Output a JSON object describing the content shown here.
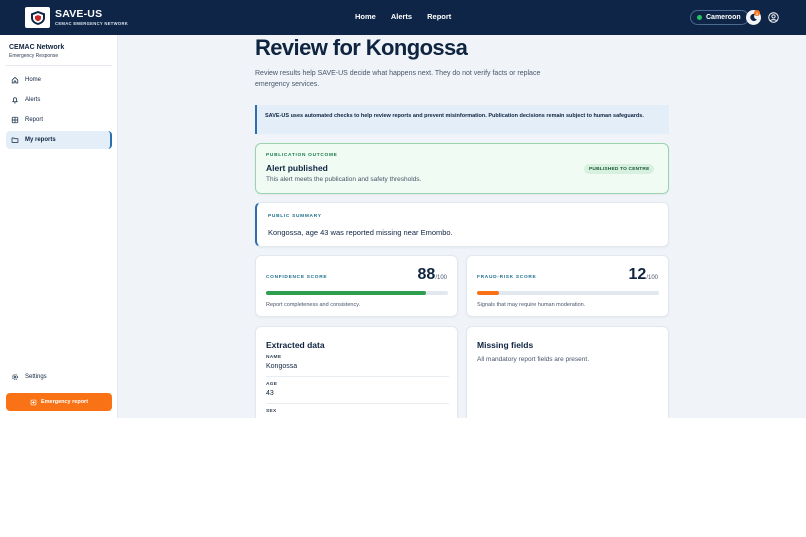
{
  "header": {
    "brand_title": "SAVE-US",
    "brand_subtitle": "CEMAC EMERGENCY NETWORK",
    "nav": [
      "Home",
      "Alerts",
      "Report"
    ],
    "country": "Cameroon",
    "notification_count": "1"
  },
  "sidebar": {
    "org_name": "CEMAC Network",
    "org_sub": "Emergency Response",
    "items": [
      {
        "label": "Home",
        "icon": "home-icon"
      },
      {
        "label": "Alerts",
        "icon": "bell-icon"
      },
      {
        "label": "Report",
        "icon": "grid-icon"
      },
      {
        "label": "My reports",
        "icon": "folder-icon"
      }
    ],
    "settings_label": "Settings",
    "emergency_label": "Emergency report"
  },
  "main": {
    "title": "Review for Kongossa",
    "intro": "Review results help SAVE-US decide what happens next. They do not verify facts or replace emergency services.",
    "notice": "SAVE-US uses automated checks to help review reports and prevent misinformation. Publication decisions remain subject to human safeguards.",
    "outcome": {
      "eyebrow": "PUBLICATION OUTCOME",
      "title": "Alert published",
      "desc": "This alert meets the publication and safety thresholds.",
      "badge": "PUBLISHED TO CENTRE"
    },
    "summary": {
      "eyebrow": "PUBLIC SUMMARY",
      "text": "Kongossa, age 43 was reported missing near Emombo."
    },
    "confidence": {
      "eyebrow": "CONFIDENCE SCORE",
      "value": "88",
      "max": "/100",
      "level": 0.88,
      "color": "#2e9e4f",
      "desc": "Report completeness and consistency."
    },
    "fraud": {
      "eyebrow": "FRAUD-RISK SCORE",
      "value": "12",
      "max": "/100",
      "level": 0.12,
      "color": "#f97316",
      "desc": "Signals that may require human moderation."
    },
    "extracted": {
      "title": "Extracted data",
      "fields": [
        {
          "label": "NAME",
          "value": "Kongossa"
        },
        {
          "label": "AGE",
          "value": "43"
        },
        {
          "label": "SEX",
          "value": ""
        }
      ]
    },
    "missing": {
      "title": "Missing fields",
      "desc": "All mandatory report fields are present."
    }
  }
}
